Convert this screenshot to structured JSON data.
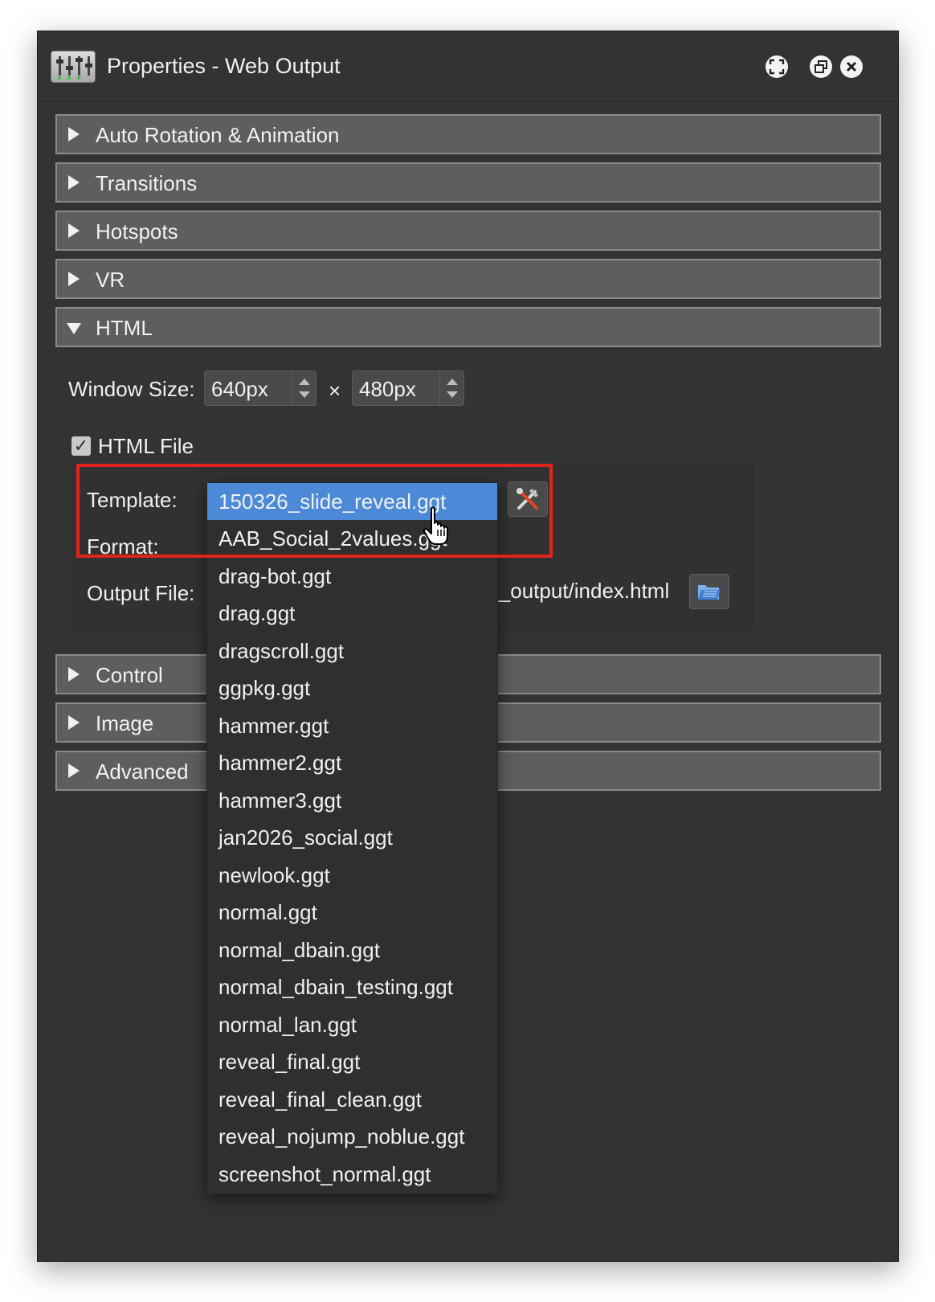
{
  "window": {
    "title": "Properties - Web Output",
    "app_icon": "sliders-icon",
    "buttons": [
      "expand-icon",
      "restore-icon",
      "close-icon"
    ]
  },
  "sections_top": [
    {
      "label": "Auto Rotation & Animation",
      "expanded": false
    },
    {
      "label": "Transitions",
      "expanded": false
    },
    {
      "label": "Hotspots",
      "expanded": false
    },
    {
      "label": "VR",
      "expanded": false
    },
    {
      "label": "HTML",
      "expanded": true
    }
  ],
  "html_section": {
    "window_size_label": "Window Size:",
    "width_value": "640px",
    "times_symbol": "×",
    "height_value": "480px",
    "html_file_checked": true,
    "html_file_label": "HTML File",
    "template_label": "Template:",
    "format_label": "Format:",
    "output_file_label": "Output File:",
    "output_file_value": "l_output/index.html"
  },
  "sections_bottom": [
    {
      "label": "Control",
      "expanded": false
    },
    {
      "label": "Image",
      "expanded": false
    },
    {
      "label": "Advanced",
      "expanded": false
    }
  ],
  "template_dropdown": {
    "selected_index": 0,
    "items": [
      "150326_slide_reveal.ggt",
      "AAB_Social_2values.ggt",
      "drag-bot.ggt",
      "drag.ggt",
      "dragscroll.ggt",
      "ggpkg.ggt",
      "hammer.ggt",
      "hammer2.ggt",
      "hammer3.ggt",
      "jan2026_social.ggt",
      "newlook.ggt",
      "normal.ggt",
      "normal_dbain.ggt",
      "normal_dbain_testing.ggt",
      "normal_lan.ggt",
      "reveal_final.ggt",
      "reveal_final_clean.ggt",
      "reveal_nojump_noblue.ggt",
      "screenshot_normal.ggt"
    ]
  },
  "colors": {
    "window_bg": "#333333",
    "section_bg": "#5e5e5e",
    "selection": "#4c8ad8",
    "highlight_box": "#e0241b"
  }
}
